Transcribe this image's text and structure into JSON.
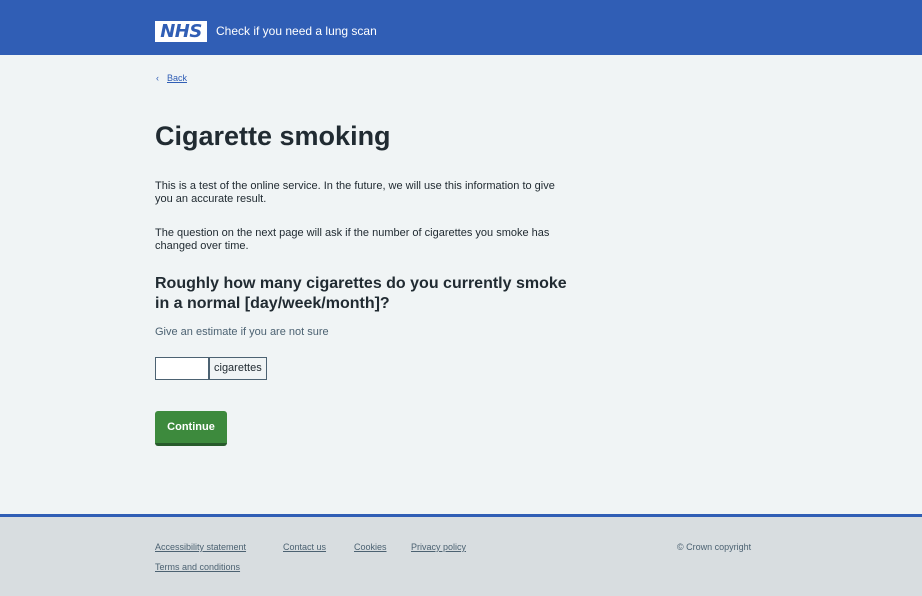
{
  "header": {
    "logo_text": "NHS",
    "service_name": "Check if you need a lung scan"
  },
  "back": {
    "chevron": "‹",
    "label": "Back"
  },
  "main": {
    "title": "Cigarette smoking",
    "paragraphs": [
      "This is a test of the online service. In the future, we will use this information to give you an accurate result.",
      "The question on the next page will ask if the number of cigarettes you smoke has changed over time."
    ],
    "question": "Roughly how many cigarettes do you currently smoke in a normal [day/week/month]?",
    "hint": "Give an estimate if you are not sure",
    "input": {
      "value": "",
      "suffix": "cigarettes"
    },
    "continue_label": "Continue"
  },
  "footer": {
    "links": [
      "Accessibility statement",
      "Contact us",
      "Cookies",
      "Privacy policy",
      "Terms and conditions"
    ],
    "copyright": "© Crown copyright"
  },
  "colors": {
    "header_blue": "#305eb5",
    "button_green": "#3d8a3d",
    "page_bg": "#f0f4f5",
    "footer_bg": "#d8dde0"
  }
}
